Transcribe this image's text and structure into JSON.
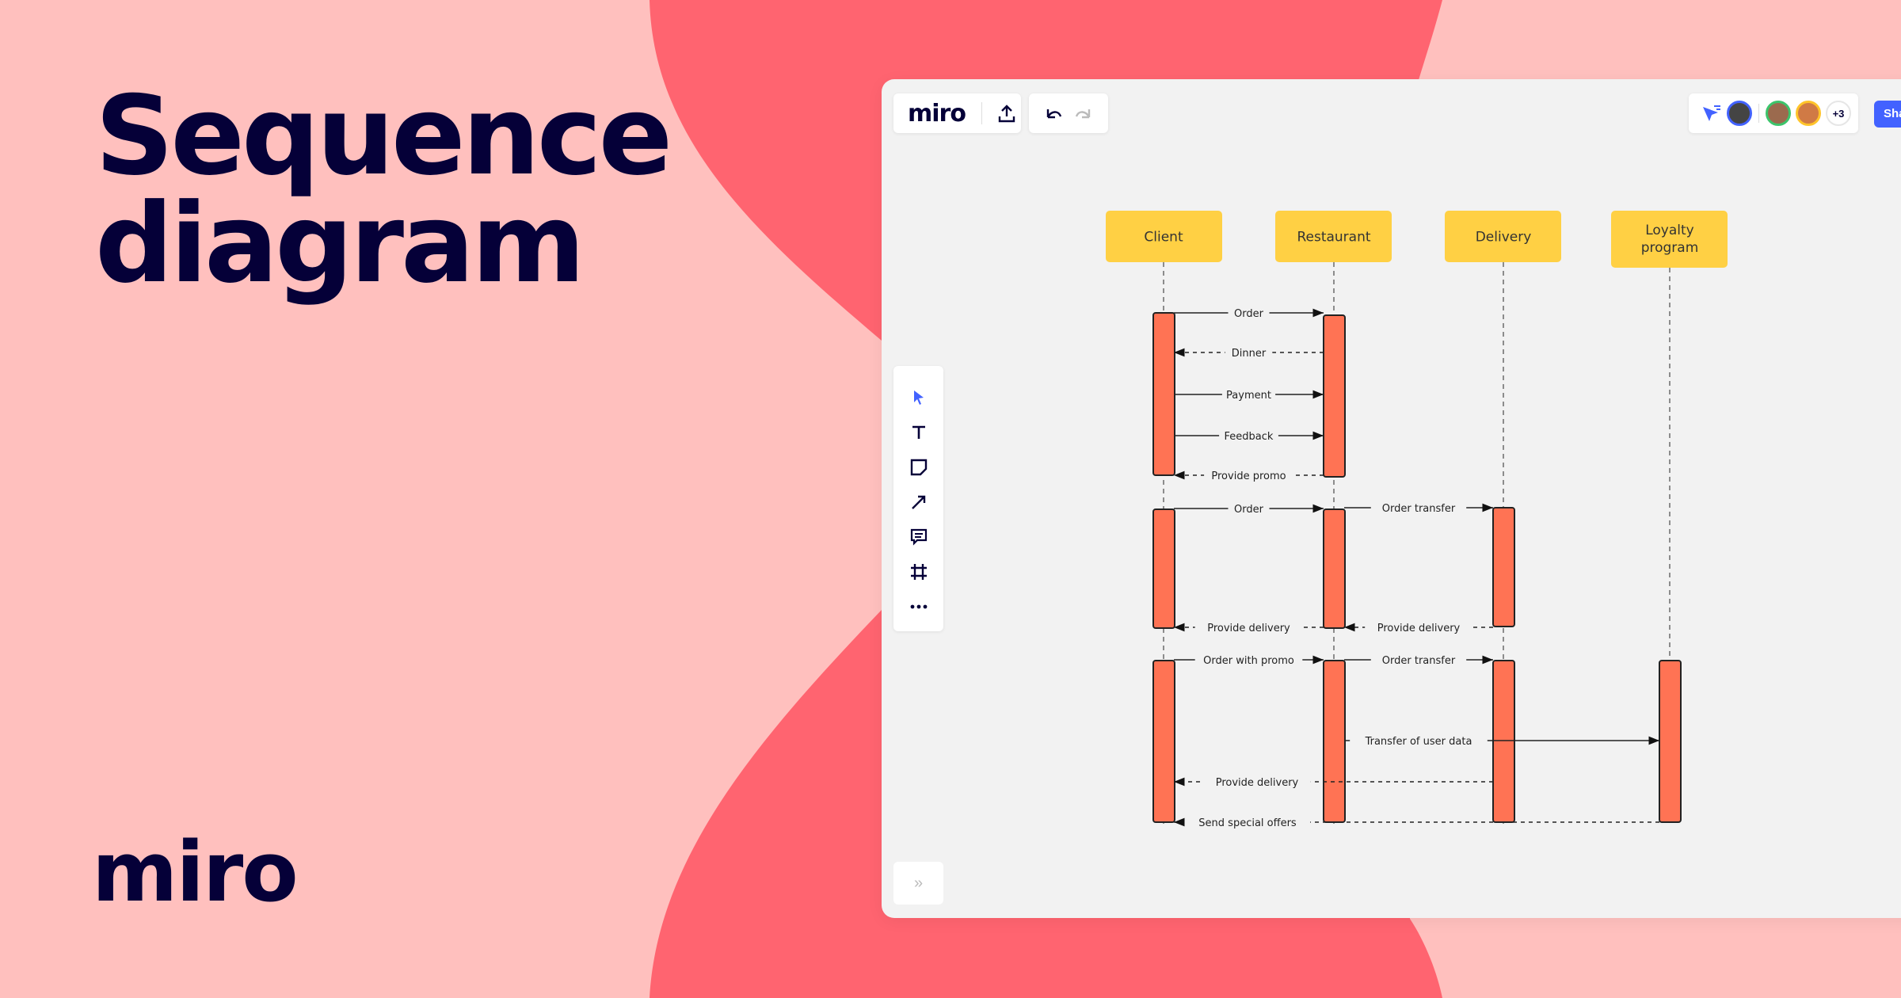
{
  "hero": {
    "line1": "Sequence",
    "line2": "diagram"
  },
  "brand_logo": "miro",
  "colors": {
    "background": "#FFC0BE",
    "blob": "#FF6470",
    "board": "#F2F2F2",
    "actor": "#FFD044",
    "activation": "#FF7354",
    "accent": "#4262FF",
    "ink": "#050038"
  },
  "board": {
    "top_toolbar": {
      "logo": "miro",
      "export_icon": "upload-icon",
      "undo_icon": "undo-icon",
      "redo_icon": "redo-icon"
    },
    "collab": {
      "extra_count": "+3",
      "share_label": "Share"
    },
    "left_toolbar": [
      "select-icon",
      "text-icon",
      "sticky-note-icon",
      "line-icon",
      "comment-icon",
      "frame-icon",
      "more-icon"
    ],
    "expand_label": "»"
  },
  "diagram": {
    "actors": [
      {
        "id": "client",
        "label": "Client"
      },
      {
        "id": "restaurant",
        "label": "Restaurant"
      },
      {
        "id": "delivery",
        "label": "Delivery"
      },
      {
        "id": "loyalty",
        "label": "Loyalty program"
      }
    ],
    "messages": [
      {
        "from": "client",
        "to": "restaurant",
        "label": "Order",
        "style": "solid"
      },
      {
        "from": "restaurant",
        "to": "client",
        "label": "Dinner",
        "style": "dashed"
      },
      {
        "from": "client",
        "to": "restaurant",
        "label": "Payment",
        "style": "solid"
      },
      {
        "from": "client",
        "to": "restaurant",
        "label": "Feedback",
        "style": "solid"
      },
      {
        "from": "restaurant",
        "to": "client",
        "label": "Provide promo",
        "style": "dashed"
      },
      {
        "from": "client",
        "to": "restaurant",
        "label": "Order",
        "style": "solid"
      },
      {
        "from": "restaurant",
        "to": "delivery",
        "label": "Order transfer",
        "style": "solid"
      },
      {
        "from": "restaurant",
        "to": "client",
        "label": "Provide delivery",
        "style": "dashed"
      },
      {
        "from": "delivery",
        "to": "restaurant",
        "label": "Provide delivery",
        "style": "dashed"
      },
      {
        "from": "client",
        "to": "restaurant",
        "label": "Order with promo",
        "style": "solid"
      },
      {
        "from": "restaurant",
        "to": "delivery",
        "label": "Order transfer",
        "style": "solid"
      },
      {
        "from": "restaurant",
        "to": "loyalty",
        "label": "Transfer of user data",
        "style": "solid"
      },
      {
        "from": "delivery",
        "to": "client",
        "label": "Provide delivery",
        "style": "dashed"
      },
      {
        "from": "loyalty",
        "to": "client",
        "label": "Send special offers",
        "style": "dashed"
      }
    ]
  }
}
